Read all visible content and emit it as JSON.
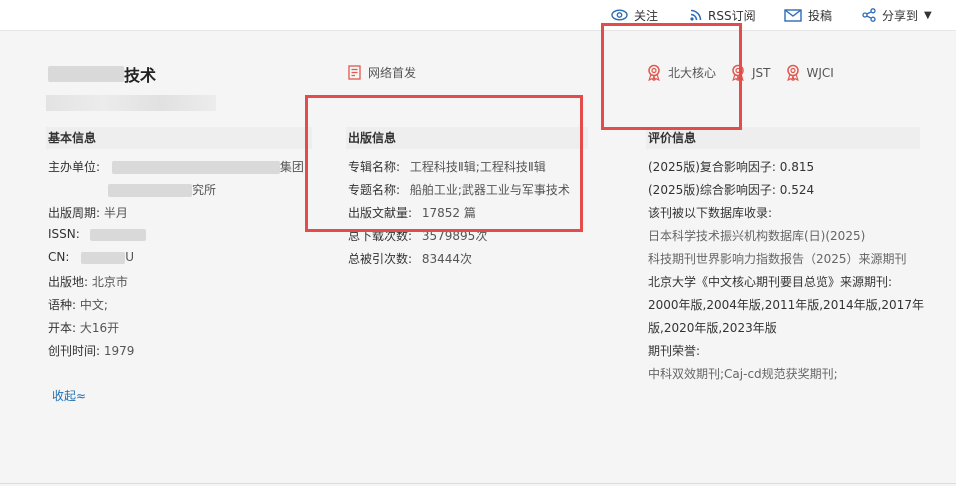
{
  "topbar": {
    "follow": "关注",
    "rss": "RSS订阅",
    "submit": "投稿",
    "share": "分享到"
  },
  "journal": {
    "title_suffix": "技术",
    "first_publish": "网络首发",
    "badges": [
      "北大核心",
      "JST",
      "WJCI"
    ]
  },
  "basic": {
    "heading": "基本信息",
    "sponsor_label": "主办单位:",
    "sponsor_line1_visible": "集团",
    "sponsor_line2_visible": "究所",
    "period_label": "出版周期:",
    "period_value": "半月",
    "issn_label": "ISSN:",
    "cn_label": "CN:",
    "cn_visible": "U",
    "place_label": "出版地:",
    "place_value": "北京市",
    "lang_label": "语种:",
    "lang_value": "中文;",
    "format_label": "开本:",
    "format_value": "大16开",
    "founded_label": "创刊时间:",
    "founded_value": "1979",
    "collapse": "收起≈"
  },
  "publish": {
    "heading": "出版信息",
    "series_label": "专辑名称:",
    "series_value": "工程科技Ⅱ辑;工程科技Ⅱ辑",
    "topic_label": "专题名称:",
    "topic_value": "船舶工业;武器工业与军事技术",
    "count_label": "出版文献量:",
    "count_value": "17852 篇",
    "downloads_label": "总下载次数:",
    "downloads_value": "3579895次",
    "citations_label": "总被引次数:",
    "citations_value": "83444次"
  },
  "evaluation": {
    "heading": "评价信息",
    "composite_if": "(2025版)复合影响因子: 0.815",
    "overall_if": "(2025版)综合影响因子: 0.524",
    "db_intro": "该刊被以下数据库收录:",
    "db1": "日本科学技术振兴机构数据库(日)(2025)",
    "db2": "科技期刊世界影响力指数报告（2025）来源期刊",
    "pku_label": "北京大学《中文核心期刊要目总览》来源期刊:",
    "pku_years1": "2000年版,2004年版,2011年版,2014年版,2017年",
    "pku_years2": "版,2020年版,2023年版",
    "honors_label": "期刊荣誉:",
    "honors_value": "中科双效期刊;Caj-cd规范获奖期刊;"
  },
  "colors": {
    "accent_red": "#e44b4b",
    "link_blue": "#1f6fb2",
    "icon_blue": "#2b6cb8",
    "badge_red": "#e0584f"
  },
  "icons": [
    "eye-icon",
    "rss-icon",
    "mail-icon",
    "share-icon",
    "document-icon",
    "award-icon"
  ]
}
